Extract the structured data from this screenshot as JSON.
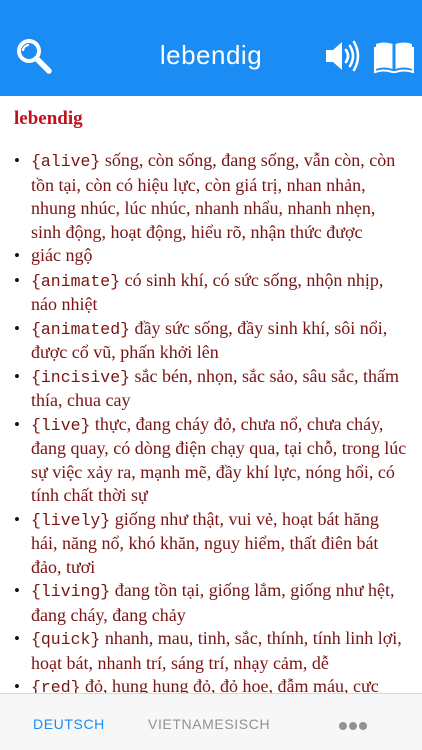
{
  "nav": {
    "title": "lebendig",
    "search_icon": "search-icon",
    "speaker_icon": "speaker-icon",
    "book_icon": "book-icon"
  },
  "entry": {
    "headword": "lebendig",
    "senses": [
      {
        "tag": "{alive}",
        "text": " sống, còn sống, đang sống, vẫn còn, còn tồn tại, còn có hiệu lực, còn giá trị, nhan nhản, nhung nhúc, lúc nhúc, nhanh nhẩu, nhanh nhẹn, sinh động, hoạt động, hiểu rõ, nhận thức được"
      },
      {
        "tag": "",
        "text": "giác ngộ"
      },
      {
        "tag": "{animate}",
        "text": " có sinh khí, có sức sống, nhộn nhịp, náo nhiệt"
      },
      {
        "tag": "{animated}",
        "text": " đầy sức sống, đầy sinh khí, sôi nổi, được cổ vũ, phấn khởi lên"
      },
      {
        "tag": "{incisive}",
        "text": " sắc bén, nhọn, sắc sảo, sâu sắc, thấm thía, chua cay"
      },
      {
        "tag": "{live}",
        "text": " thực, đang cháy đỏ, chưa nổ, chưa cháy, đang quay, có dòng điện chạy qua, tại chỗ, trong lúc sự việc xảy ra, mạnh mẽ, đầy khí lực, nóng hổi, có tính chất thời sự"
      },
      {
        "tag": "{lively}",
        "text": " giống như thật, vui vẻ, hoạt bát hăng hái, năng nổ, khó khăn, nguy hiểm, thất điên bát đảo, tươi"
      },
      {
        "tag": "{living}",
        "text": " đang tồn tại, giống lắm, giống như hệt, đang cháy, đang chảy"
      },
      {
        "tag": "{quick}",
        "text": " nhanh, mau, tinh, sắc, thính, tính linh lợi, hoạt bát, nhanh trí, sáng trí, nhạy cảm, dễ"
      },
      {
        "tag": "{red}",
        "text": " đỏ, hung hung đỏ, đỏ hoe, đẫm máu, cực đoan"
      }
    ]
  },
  "tabbar": {
    "tab_de": "DEUTSCH",
    "tab_vn": "VIETNAMESISCH",
    "more": "•••",
    "active_color": "#1a8cf3",
    "inactive_color": "#929292"
  },
  "colors": {
    "nav_bg": "#1a8cf3",
    "headword": "#c0101c",
    "body_text": "#7a1313"
  }
}
